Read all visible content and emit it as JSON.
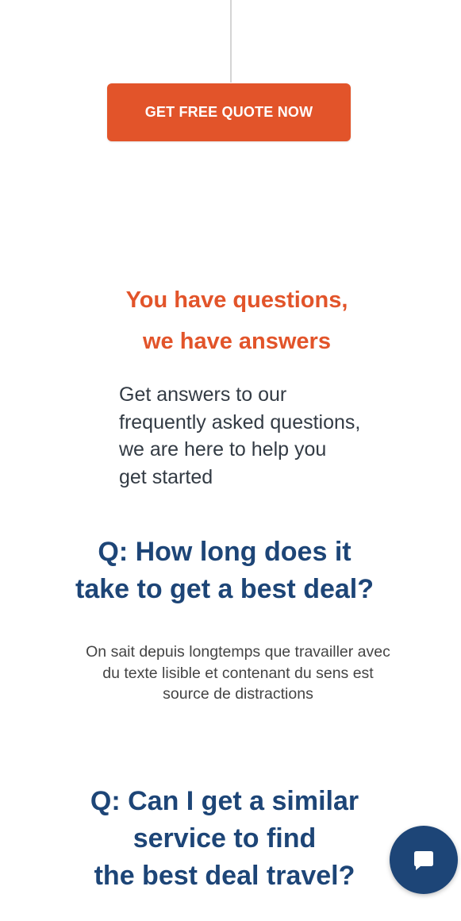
{
  "cta": {
    "label": "GET FREE QUOTE NOW"
  },
  "faq": {
    "heading_line1": "You have questions,",
    "heading_line2": "we have answers",
    "intro_lines": [
      "Get answers to our",
      "frequently asked questions,",
      "we are here to help you",
      "get started"
    ],
    "questions": [
      {
        "question_lines": [
          "Q: How long does it",
          "take to get a best deal?"
        ],
        "answer_lines": [
          "On sait depuis longtemps que travailler avec",
          "du texte lisible et contenant du sens est",
          "source de distractions"
        ]
      },
      {
        "question_lines": [
          "Q: Can I get a similar",
          "service to find",
          "the best deal travel?"
        ]
      }
    ]
  },
  "chat": {
    "icon": "chat-bubble-icon"
  },
  "colors": {
    "accent_orange": "#e2542a",
    "navy": "#1d4577",
    "body_text": "#333b44",
    "divider": "#d4d4d4"
  }
}
